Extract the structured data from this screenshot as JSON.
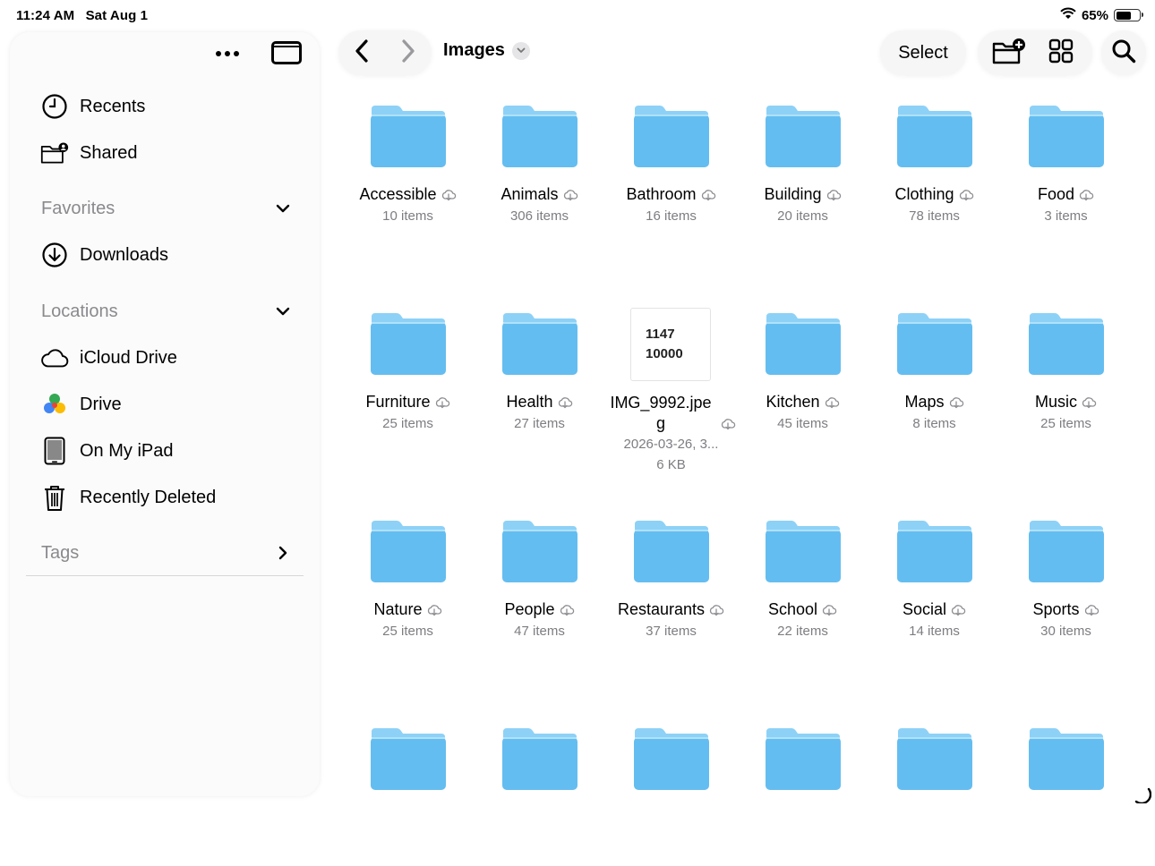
{
  "status_bar": {
    "time": "11:24 AM",
    "date": "Sat Aug 1",
    "battery": "65%",
    "battery_level": 0.65
  },
  "sidebar": {
    "top_items": [
      {
        "label": "Recents",
        "icon": "clock-icon"
      },
      {
        "label": "Shared",
        "icon": "shared-folder-icon"
      }
    ],
    "favorites": {
      "title": "Favorites",
      "items": [
        {
          "label": "Downloads",
          "icon": "download-circle-icon"
        }
      ]
    },
    "locations": {
      "title": "Locations",
      "items": [
        {
          "label": "iCloud Drive",
          "icon": "cloud-icon"
        },
        {
          "label": "Drive",
          "icon": "google-drive-icon"
        },
        {
          "label": "On My iPad",
          "icon": "ipad-icon"
        },
        {
          "label": "Recently Deleted",
          "icon": "trash-icon"
        }
      ]
    },
    "tags": {
      "title": "Tags"
    }
  },
  "toolbar": {
    "title": "Images",
    "select_label": "Select"
  },
  "colors": {
    "folder_top": "#8dd1f7",
    "folder_body": "#64bdf0",
    "secondary_text": "#7d7d82"
  },
  "items": [
    {
      "name": "Accessible",
      "sub": "10 items"
    },
    {
      "name": "Animals",
      "sub": "306 items"
    },
    {
      "name": "Bathroom",
      "sub": "16 items"
    },
    {
      "name": "Building",
      "sub": "20 items"
    },
    {
      "name": "Clothing",
      "sub": "78 items"
    },
    {
      "name": "Food",
      "sub": "3 items"
    },
    {
      "name": "Furniture",
      "sub": "25 items"
    },
    {
      "name": "Health",
      "sub": "27 items"
    },
    {
      "name": "IMG_9992.jpe g",
      "sub": "2026-03-26, 3...",
      "sub2": "6 KB",
      "thumb_line1": "1147",
      "thumb_line2": "10000",
      "is_file": true
    },
    {
      "name": "Kitchen",
      "sub": "45 items"
    },
    {
      "name": "Maps",
      "sub": "8 items"
    },
    {
      "name": "Music",
      "sub": "25 items"
    },
    {
      "name": "Nature",
      "sub": "25 items"
    },
    {
      "name": "People",
      "sub": "47 items"
    },
    {
      "name": "Restaurants",
      "sub": "37 items"
    },
    {
      "name": "School",
      "sub": "22 items"
    },
    {
      "name": "Social",
      "sub": "14 items"
    },
    {
      "name": "Sports",
      "sub": "30 items"
    }
  ],
  "partial_row_count": 6
}
